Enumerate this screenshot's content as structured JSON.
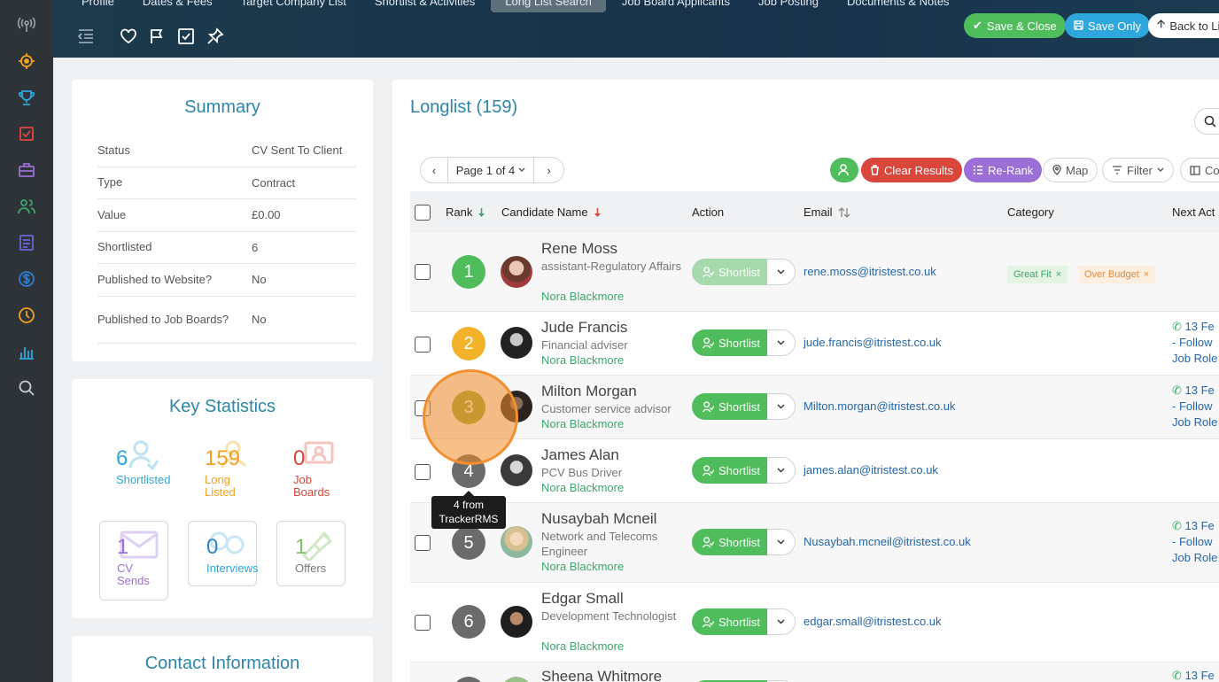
{
  "header": {
    "tabs": [
      "Profile",
      "Dates & Fees",
      "Target Company List",
      "Shortlist & Activities",
      "Long List Search",
      "Job Board Applicants",
      "Job Posting",
      "Documents & Notes"
    ],
    "active_tab_index": 4,
    "buttons": {
      "save_close": "Save & Close",
      "save_only": "Save Only",
      "back": "Back to Li"
    },
    "icons": [
      "collapse-icon",
      "heart-icon",
      "flag-icon",
      "checkbox-icon",
      "pin-icon"
    ]
  },
  "rail": {
    "icons": [
      "broadcast-icon",
      "target-icon",
      "trophy-icon",
      "tasks-icon",
      "briefcase-icon",
      "people-icon",
      "document-icon",
      "money-icon",
      "clock-icon",
      "chart-icon",
      "search-icon"
    ]
  },
  "summary": {
    "title": "Summary",
    "rows": [
      {
        "label": "Status",
        "value": "CV Sent To Client"
      },
      {
        "label": "Type",
        "value": "Contract"
      },
      {
        "label": "Value",
        "value": "£0.00"
      },
      {
        "label": "Shortlisted",
        "value": "6"
      },
      {
        "label": "Published to Website?",
        "value": "No"
      },
      {
        "label": "Published to Job Boards?",
        "value": "No"
      }
    ]
  },
  "key_stats": {
    "title": "Key Statistics",
    "shortlisted": {
      "num": "6",
      "label": "Shortlisted"
    },
    "long_listed": {
      "num": "159",
      "label": "Long Listed"
    },
    "job_boards": {
      "num": "0",
      "label": "Job Boards"
    },
    "cv_sends": {
      "num": "1",
      "label": "CV Sends"
    },
    "interviews": {
      "num": "0",
      "label": "Interviews"
    },
    "offers": {
      "num": "1",
      "label": "Offers"
    }
  },
  "contact": {
    "title": "Contact Information"
  },
  "longlist": {
    "title": "Longlist (159)",
    "pager": "Page 1 of 4",
    "toolbar": {
      "clear": "Clear Results",
      "rerank": "Re-Rank",
      "map": "Map",
      "filter": "Filter",
      "columns": "Co"
    },
    "columns": {
      "rank": "Rank",
      "name": "Candidate Name",
      "action": "Action",
      "email": "Email",
      "category": "Category",
      "next": "Next Act"
    },
    "shortlist_label": "Shortlist",
    "rows": [
      {
        "rank": "1",
        "name": "Rene Moss",
        "role": "assistant-Regulatory Affairs",
        "owner": "Nora Blackmore",
        "email": "rene.moss@itristest.co.uk",
        "tags": [
          "Great Fit",
          "Over Budget"
        ],
        "next": []
      },
      {
        "rank": "2",
        "name": "Jude Francis",
        "role": "Financial adviser",
        "owner": "Nora Blackmore",
        "email": "jude.francis@itristest.co.uk",
        "tags": [],
        "next": [
          "13 Fe",
          "- Follow",
          "Job Role"
        ]
      },
      {
        "rank": "3",
        "name": "Milton Morgan",
        "role": "Customer service advisor",
        "owner": "Nora Blackmore",
        "email": "Milton.morgan@itristest.co.uk",
        "tags": [],
        "next": [
          "13 Fe",
          "- Follow",
          "Job Role"
        ]
      },
      {
        "rank": "4",
        "name": "James Alan",
        "role": "PCV Bus Driver",
        "owner": "Nora Blackmore",
        "email": "james.alan@itristest.co.uk",
        "tags": [],
        "next": []
      },
      {
        "rank": "5",
        "name": "Nusaybah Mcneil",
        "role": "Network and Telecoms Engineer",
        "owner": "Nora Blackmore",
        "email": "Nusaybah.mcneil@itristest.co.uk",
        "tags": [],
        "next": [
          "13 Fe",
          "- Follow",
          "Job Role"
        ]
      },
      {
        "rank": "6",
        "name": "Edgar Small",
        "role": "Development Technologist",
        "owner": "Nora Blackmore",
        "email": "edgar.small@itristest.co.uk",
        "tags": [],
        "next": []
      },
      {
        "rank": "7",
        "name": "Sheena Whitmore",
        "role": "",
        "owner": "",
        "email": "",
        "tags": [],
        "next": [
          "13 Fe"
        ]
      }
    ],
    "tooltip": "4 from TrackerRMS"
  },
  "colors": {
    "accent": "#2b86a8",
    "green": "#4fbd5b",
    "red": "#d9473c",
    "purple": "#9b6fd6",
    "blue_btn": "#2ea7dc",
    "rank_colors": [
      "#4fbd5b",
      "#f2b22a",
      "#9aa63a",
      "#6b6b6b",
      "#6b6b6b",
      "#6b6b6b",
      "#6b6b6b"
    ]
  }
}
